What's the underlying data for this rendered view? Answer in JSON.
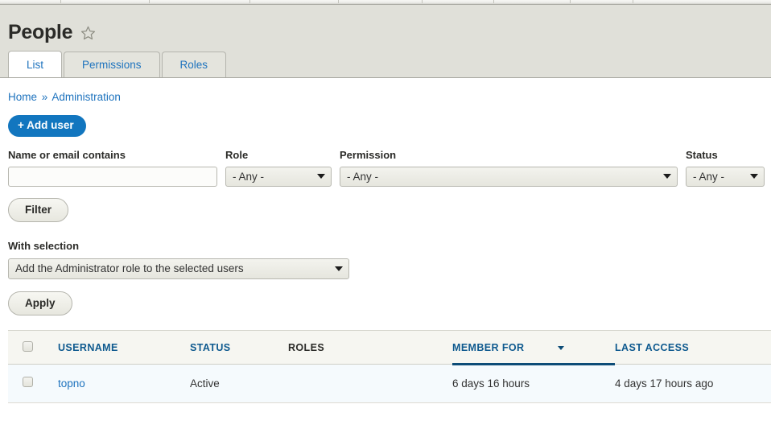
{
  "toolbar": {
    "separator_positions": [
      75,
      185,
      310,
      420,
      524,
      613,
      708,
      786
    ]
  },
  "header": {
    "title": "People",
    "star_icon": "star-outline-icon",
    "background": "#e0e0d9"
  },
  "tabs": [
    {
      "label": "List",
      "active": true
    },
    {
      "label": "Permissions",
      "active": false
    },
    {
      "label": "Roles",
      "active": false
    }
  ],
  "breadcrumb": {
    "items": [
      "Home",
      "Administration"
    ],
    "separator": "»"
  },
  "actions": {
    "add_user_label": "+ Add user",
    "add_user_color": "#1276bf"
  },
  "filters": {
    "name": {
      "label": "Name or email contains",
      "value": "",
      "placeholder": ""
    },
    "role": {
      "label": "Role",
      "value": "- Any -"
    },
    "permission": {
      "label": "Permission",
      "value": "- Any -"
    },
    "status": {
      "label": "Status",
      "value": "- Any -"
    },
    "filter_button": "Filter"
  },
  "bulk": {
    "label": "With selection",
    "action_value": "Add the Administrator role to the selected users",
    "apply_button": "Apply"
  },
  "table": {
    "columns": [
      {
        "key": "checkbox",
        "label": "",
        "sortable": false
      },
      {
        "key": "username",
        "label": "USERNAME",
        "sortable": true
      },
      {
        "key": "status",
        "label": "STATUS",
        "sortable": true
      },
      {
        "key": "roles",
        "label": "ROLES",
        "sortable": false
      },
      {
        "key": "member_for",
        "label": "MEMBER FOR",
        "sortable": true,
        "active_sort": true,
        "sort_direction": "desc"
      },
      {
        "key": "last_access",
        "label": "LAST ACCESS",
        "sortable": true
      }
    ],
    "rows": [
      {
        "username": "topno",
        "status": "Active",
        "roles": "",
        "member_for": "6 days 16 hours",
        "last_access": "4 days 17 hours ago"
      }
    ]
  }
}
